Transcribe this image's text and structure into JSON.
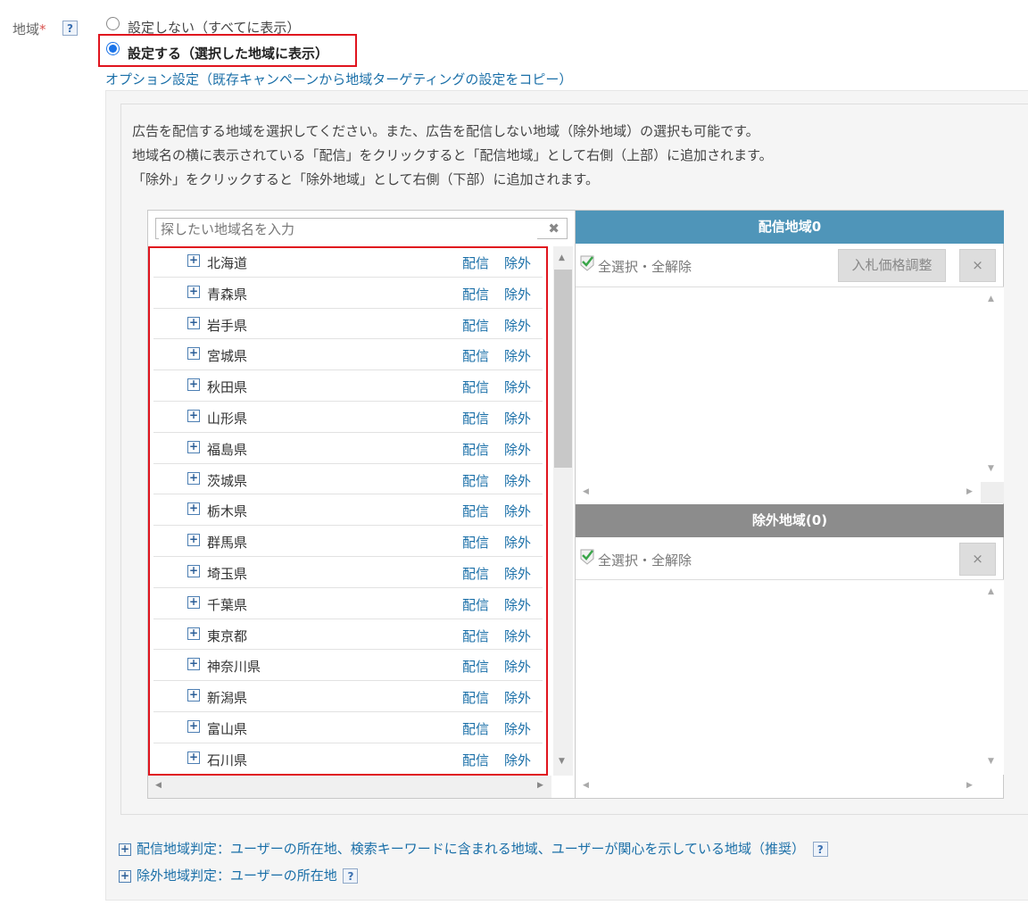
{
  "field": {
    "label": "地域",
    "required_mark": "*",
    "help": "?"
  },
  "radios": [
    {
      "label": "設定しない（すべてに表示）",
      "selected": false
    },
    {
      "label": "設定する（選択した地域に表示）",
      "selected": true
    }
  ],
  "option_link": "オプション設定（既存キャンペーンから地域ターゲティングの設定をコピー）",
  "description": [
    "広告を配信する地域を選択してください。また、広告を配信しない地域（除外地域）の選択も可能です。",
    "地域名の横に表示されている「配信」をクリックすると「配信地域」として右側（上部）に追加されます。",
    "「除外」をクリックすると「除外地域」として右側（下部）に追加されます。"
  ],
  "search": {
    "placeholder": "探したい地域名を入力",
    "clear": "✖"
  },
  "action_labels": {
    "deliver": "配信",
    "exclude": "除外"
  },
  "prefectures": [
    "北海道",
    "青森県",
    "岩手県",
    "宮城県",
    "秋田県",
    "山形県",
    "福島県",
    "茨城県",
    "栃木県",
    "群馬県",
    "埼玉県",
    "千葉県",
    "東京都",
    "神奈川県",
    "新潟県",
    "富山県",
    "石川県"
  ],
  "delivery_panel": {
    "title": "配信地域0",
    "select_all": "全選択・全解除",
    "bid_button": "入札価格調整",
    "remove_button": "×"
  },
  "exclude_panel": {
    "title": "除外地域(0)",
    "select_all": "全選択・全解除",
    "remove_button": "×"
  },
  "footer": [
    {
      "label": "配信地域判定：ユーザーの所在地、検索キーワードに含まれる地域、ユーザーが関心を示している地域（推奨）",
      "help": "?"
    },
    {
      "label": "除外地域判定：ユーザーの所在地",
      "help": "?"
    }
  ],
  "colors": {
    "accent": "#1a6fa8",
    "highlight_border": "#e0141e",
    "delivery_header": "#4f95b9",
    "exclude_header": "#8c8c8c"
  }
}
